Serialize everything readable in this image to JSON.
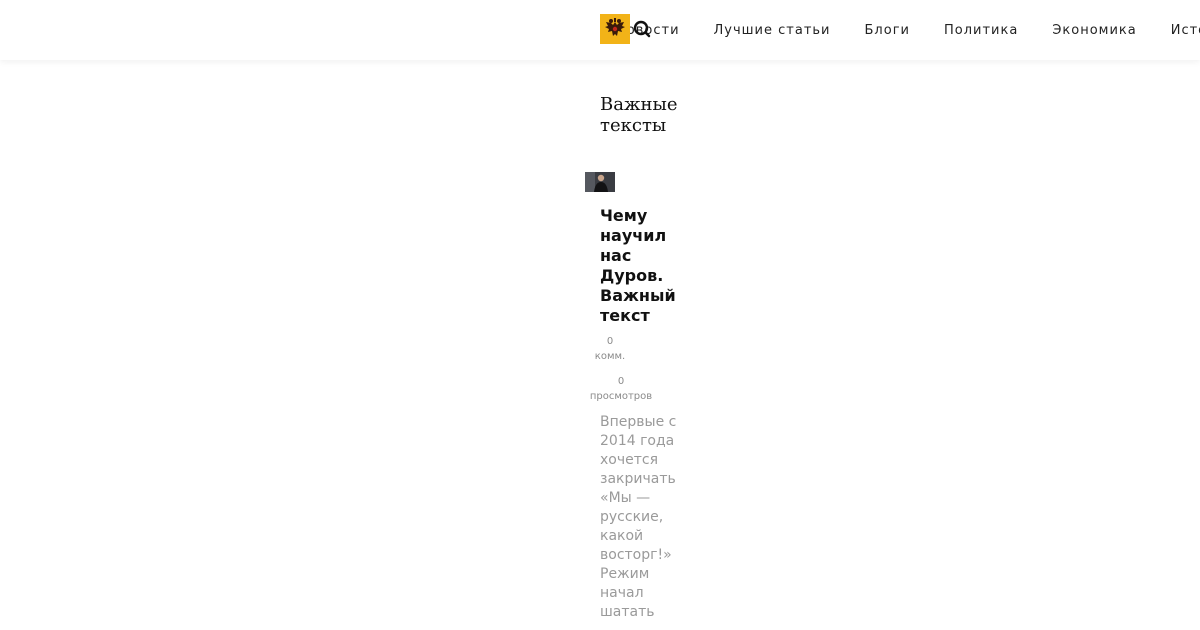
{
  "header": {
    "logo_icon": "double-headed-eagle-icon",
    "search_icon": "search-icon",
    "colors": {
      "logo_background": "#f2b318",
      "text": "#222222"
    },
    "nav": [
      {
        "label": "Новости"
      },
      {
        "label": "Лучшие статьи"
      },
      {
        "label": "Блоги"
      },
      {
        "label": "Политика"
      },
      {
        "label": "Экономика"
      },
      {
        "label": "История"
      }
    ]
  },
  "main": {
    "section_title": "Важные тексты",
    "article": {
      "title": "Чему научил нас Дуров. Важный текст",
      "comments_count": "0",
      "comments_label": "комм.",
      "views_count": "0",
      "views_label": "просмотров",
      "excerpt": "Впервые с 2014 года хочется закричать «Мы — русские, какой восторг!» Режим начал шатать"
    }
  }
}
